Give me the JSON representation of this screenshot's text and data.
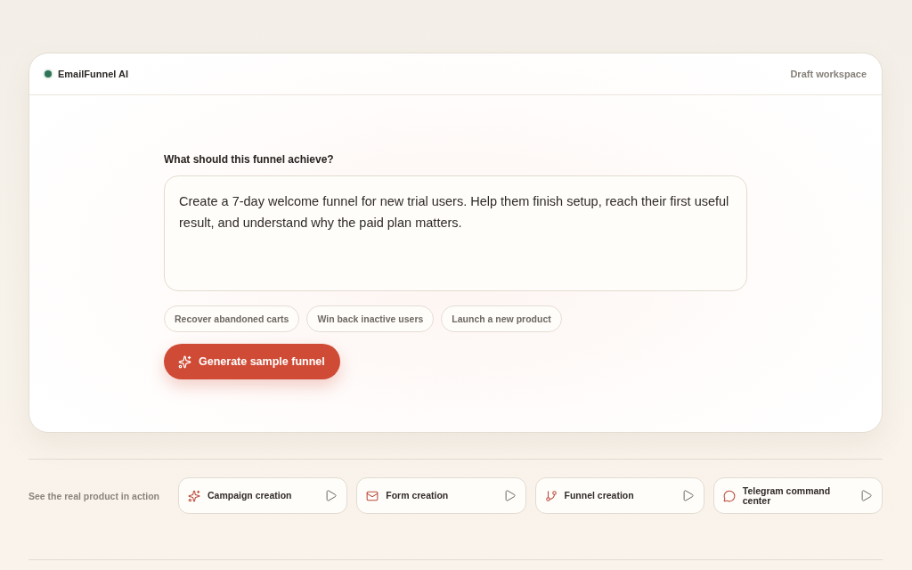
{
  "app": {
    "name": "EmailFunnel AI",
    "status": "Draft workspace"
  },
  "prompt": {
    "label": "What should this funnel achieve?",
    "value": "Create a 7-day welcome funnel for new trial users. Help them finish setup, reach their first useful result, and understand why the paid plan matters."
  },
  "suggestions": [
    "Recover abandoned carts",
    "Win back inactive users",
    "Launch a new product"
  ],
  "generate_button": {
    "label": "Generate sample funnel"
  },
  "demos": {
    "label": "See the real product in action",
    "items": [
      {
        "title": "Campaign creation"
      },
      {
        "title": "Form creation"
      },
      {
        "title": "Funnel creation"
      },
      {
        "title": "Telegram command center"
      }
    ]
  }
}
